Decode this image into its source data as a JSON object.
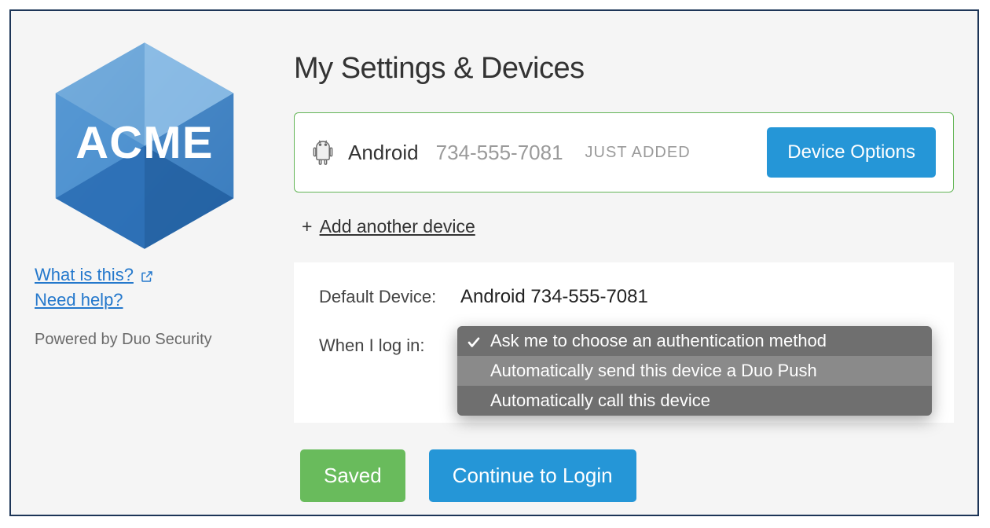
{
  "sidebar": {
    "logo_text": "ACME",
    "what_is_this": "What is this?",
    "need_help": "Need help?",
    "powered_by": "Powered by Duo Security"
  },
  "main": {
    "title": "My Settings & Devices",
    "device": {
      "platform": "Android",
      "number": "734-555-7081",
      "badge": "JUST ADDED",
      "options_btn": "Device Options"
    },
    "add_device": {
      "plus": "+",
      "label": "Add another device"
    },
    "settings": {
      "default_label": "Default Device:",
      "default_value": "Android 734-555-7081",
      "when_login_label": "When I log in:",
      "dropdown": {
        "options": [
          "Ask me to choose an authentication method",
          "Automatically send this device a Duo Push",
          "Automatically call this device"
        ],
        "selected_index": 0,
        "hovered_index": 1
      }
    },
    "buttons": {
      "saved": "Saved",
      "continue": "Continue to Login"
    }
  }
}
